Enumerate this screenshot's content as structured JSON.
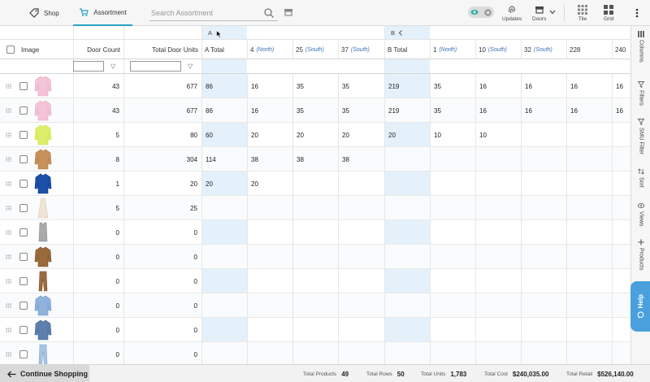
{
  "topbar": {
    "tabs": [
      {
        "label": "Shop"
      },
      {
        "label": "Assortment"
      }
    ],
    "search_placeholder": "Search Assortment",
    "updates_label": "Updates",
    "doors_label": "Doors",
    "tile_label": "Tile",
    "grid_label": "Grid",
    "accent_color": "#2aa3c7"
  },
  "grid": {
    "groups": [
      {
        "label": "A"
      },
      {
        "label": "B"
      }
    ],
    "image_header": "Image",
    "columns": [
      {
        "label": "Door Count",
        "sub": ""
      },
      {
        "label": "Total Door Units",
        "sub": ""
      },
      {
        "label": "A Total",
        "sub": ""
      },
      {
        "label": "4",
        "sub": "(North)"
      },
      {
        "label": "25",
        "sub": "(South)"
      },
      {
        "label": "37",
        "sub": "(South)"
      },
      {
        "label": "B Total",
        "sub": ""
      },
      {
        "label": "1",
        "sub": "(North)"
      },
      {
        "label": "10",
        "sub": "(South)"
      },
      {
        "label": "32",
        "sub": "(South)"
      },
      {
        "label": "228",
        "sub": ""
      },
      {
        "label": "240",
        "sub": ""
      }
    ],
    "rows": [
      {
        "product": "pink knit top",
        "cells": [
          "43",
          "677",
          "86",
          "16",
          "35",
          "35",
          "219",
          "35",
          "16",
          "16",
          "16",
          "16"
        ]
      },
      {
        "product": "pink knit top",
        "cells": [
          "43",
          "677",
          "86",
          "16",
          "35",
          "35",
          "219",
          "35",
          "16",
          "16",
          "16",
          "16"
        ]
      },
      {
        "product": "lime sweater",
        "cells": [
          "5",
          "80",
          "60",
          "20",
          "20",
          "20",
          "20",
          "10",
          "10",
          "",
          "",
          ""
        ]
      },
      {
        "product": "tan sweater",
        "cells": [
          "8",
          "304",
          "114",
          "38",
          "38",
          "38",
          "",
          "",
          "",
          "",
          "",
          ""
        ]
      },
      {
        "product": "blue cardigan",
        "cells": [
          "1",
          "20",
          "20",
          "20",
          "",
          "",
          "",
          "",
          "",
          "",
          "",
          ""
        ]
      },
      {
        "product": "cream dress",
        "cells": [
          "5",
          "25",
          "",
          "",
          "",
          "",
          "",
          "",
          "",
          "",
          "",
          ""
        ]
      },
      {
        "product": "grey vest",
        "cells": [
          "0",
          "0",
          "",
          "",
          "",
          "",
          "",
          "",
          "",
          "",
          "",
          ""
        ]
      },
      {
        "product": "brown jacket",
        "cells": [
          "0",
          "0",
          "",
          "",
          "",
          "",
          "",
          "",
          "",
          "",
          "",
          ""
        ]
      },
      {
        "product": "brown trousers",
        "cells": [
          "0",
          "0",
          "",
          "",
          "",
          "",
          "",
          "",
          "",
          "",
          "",
          ""
        ]
      },
      {
        "product": "light blue shirt",
        "cells": [
          "0",
          "0",
          "",
          "",
          "",
          "",
          "",
          "",
          "",
          "",
          "",
          ""
        ]
      },
      {
        "product": "denim blazer",
        "cells": [
          "0",
          "0",
          "",
          "",
          "",
          "",
          "",
          "",
          "",
          "",
          "",
          ""
        ]
      },
      {
        "product": "light blue jeans",
        "cells": [
          "0",
          "0",
          "",
          "",
          "",
          "",
          "",
          "",
          "",
          "",
          "",
          ""
        ]
      }
    ]
  },
  "sidebar": {
    "items": [
      {
        "label": "Columns"
      },
      {
        "label": "Filters"
      },
      {
        "label": "SMU Filter"
      },
      {
        "label": "Sort"
      },
      {
        "label": "Views"
      },
      {
        "label": "Products"
      }
    ],
    "help_label": "Help"
  },
  "footer": {
    "continue_label": "Continue Shopping",
    "stats": [
      {
        "label": "Total Products",
        "value": "49"
      },
      {
        "label": "Total Rows",
        "value": "50"
      },
      {
        "label": "Total Units",
        "value": "1,783"
      },
      {
        "label": "Total Cost",
        "value": "$240,035.00"
      },
      {
        "label": "Total Retail",
        "value": "$526,140.00"
      }
    ]
  }
}
